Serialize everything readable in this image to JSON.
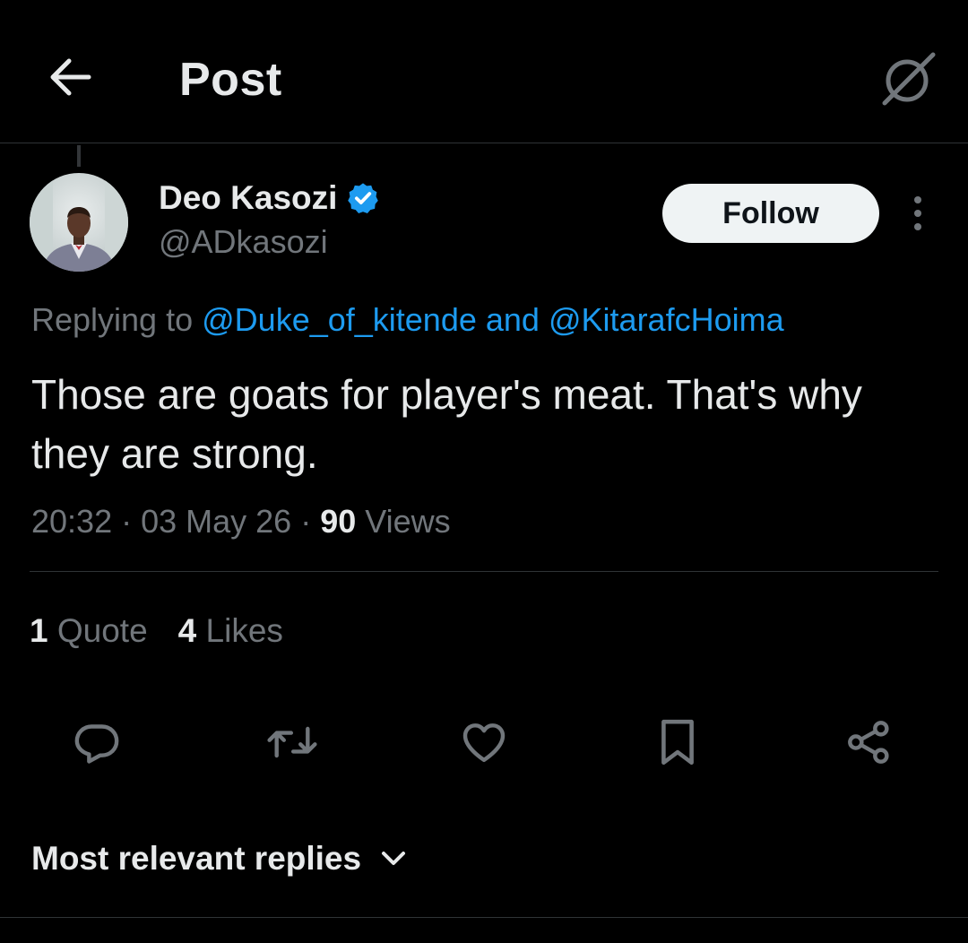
{
  "header": {
    "title": "Post",
    "back_icon": "arrow-left-icon",
    "grok_icon": "grok-icon"
  },
  "author": {
    "display_name": "Deo Kasozi",
    "handle": "@ADkasozi",
    "verified": true,
    "verified_color": "#1d9bf0"
  },
  "follow_button": {
    "label": "Follow"
  },
  "reply_context": {
    "prefix": "Replying to",
    "mention1": "@Duke_of_kitende",
    "joiner": "and",
    "mention2": "@KitarafcHoima"
  },
  "tweet": {
    "text": "Those are goats for player's meat. That's why they are strong.",
    "time": "20:32",
    "date": "03 May 26",
    "views_count": "90",
    "views_label": "Views"
  },
  "stats": {
    "quotes_count": "1",
    "quotes_label": "Quote",
    "likes_count": "4",
    "likes_label": "Likes"
  },
  "actions": [
    "reply-icon",
    "repost-icon",
    "like-icon",
    "bookmark-icon",
    "share-icon"
  ],
  "replies_sort": {
    "label": "Most relevant replies"
  },
  "colors": {
    "background": "#000000",
    "text_primary": "#e7e9ea",
    "text_secondary": "#71767b",
    "accent": "#1d9bf0",
    "divider": "#2f3336"
  }
}
